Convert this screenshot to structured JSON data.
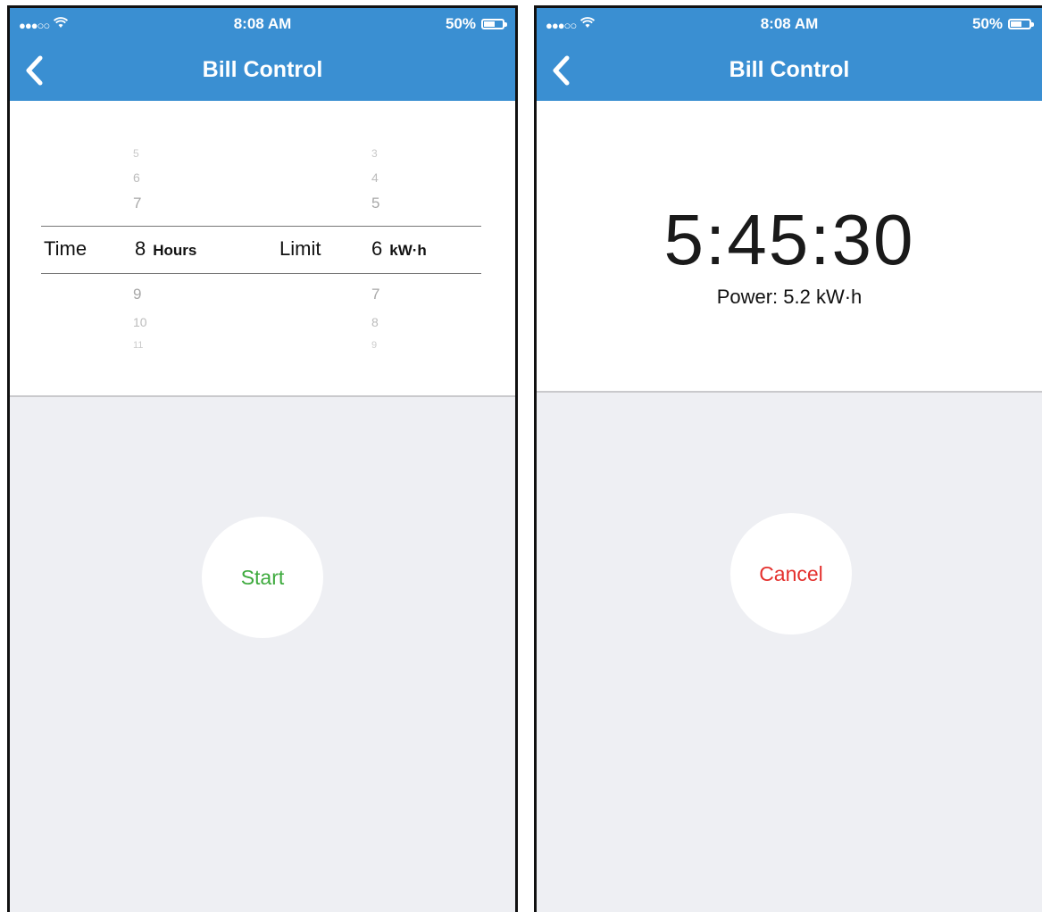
{
  "screens": [
    {
      "status": {
        "signal": "●●●○○",
        "time": "8:08 AM",
        "battery": "50%"
      },
      "nav": {
        "title": "Bill Control"
      },
      "picker": {
        "time_label": "Time",
        "time_above": [
          "5",
          "6",
          "7"
        ],
        "time_selected": "8",
        "time_unit": "Hours",
        "time_below": [
          "9",
          "10",
          "11"
        ],
        "limit_label": "Limit",
        "limit_above": [
          "3",
          "4",
          "5"
        ],
        "limit_selected": "6",
        "limit_unit": "kW·h",
        "limit_below": [
          "7",
          "8",
          "9"
        ]
      },
      "action": {
        "label": "Start",
        "color": "#3daa3d"
      }
    },
    {
      "status": {
        "signal": "●●●○○",
        "time": "8:08 AM",
        "battery": "50%"
      },
      "nav": {
        "title": "Bill Control"
      },
      "countdown": "5:45:30",
      "power": "Power: 5.2 kW·h",
      "action": {
        "label": "Cancel",
        "color": "#e4302d"
      }
    }
  ],
  "colors": {
    "header": "#3a8fd2",
    "background": "#eeeff3",
    "panel": "#ffffff"
  },
  "icons": {
    "back": "chevron-left-icon",
    "wifi": "wifi-icon",
    "battery": "battery-icon"
  }
}
